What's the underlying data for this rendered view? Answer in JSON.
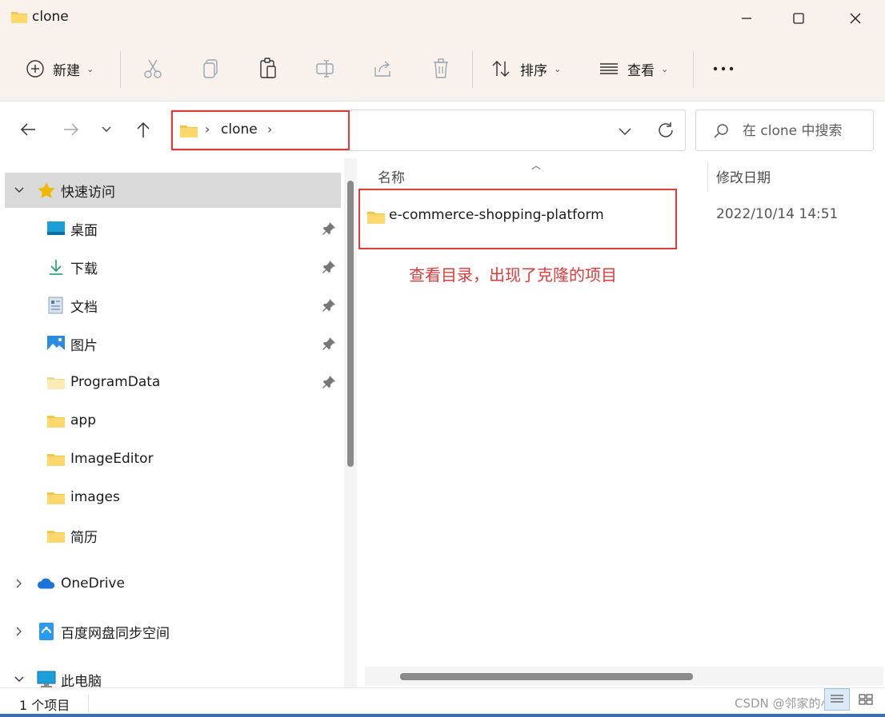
{
  "window": {
    "title": "clone"
  },
  "toolbar": {
    "new_label": "新建",
    "sort_label": "排序",
    "view_label": "查看"
  },
  "address": {
    "crumb": "clone",
    "separator": "›",
    "search_placeholder": "在 clone 中搜索"
  },
  "nav": {
    "quick_access": "快速访问",
    "items": [
      {
        "label": "桌面",
        "icon": "desktop-icon",
        "pinned": true
      },
      {
        "label": "下载",
        "icon": "download-icon",
        "pinned": true
      },
      {
        "label": "文档",
        "icon": "document-icon",
        "pinned": true
      },
      {
        "label": "图片",
        "icon": "pictures-icon",
        "pinned": true
      },
      {
        "label": "ProgramData",
        "icon": "folder-icon",
        "pinned": true
      },
      {
        "label": "app",
        "icon": "folder-icon",
        "pinned": false
      },
      {
        "label": "ImageEditor",
        "icon": "folder-icon",
        "pinned": false
      },
      {
        "label": "images",
        "icon": "folder-icon",
        "pinned": false
      },
      {
        "label": "简历",
        "icon": "folder-icon",
        "pinned": false
      }
    ],
    "onedrive": "OneDrive",
    "baidu": "百度网盘同步空间",
    "this_pc": "此电脑"
  },
  "content": {
    "col_name": "名称",
    "col_date": "修改日期",
    "files": [
      {
        "name": "e-commerce-shopping-platform",
        "date": "2022/10/14 14:51"
      }
    ],
    "annotation": "查看目录，出现了克隆的项目"
  },
  "status": {
    "count": "1 个项目",
    "watermark": "CSDN @邻家的小猫"
  },
  "colors": {
    "accent_red": "#e03a3a",
    "folder_yellow": "#f5c542",
    "toolbar_bg": "#f8f1ec"
  }
}
